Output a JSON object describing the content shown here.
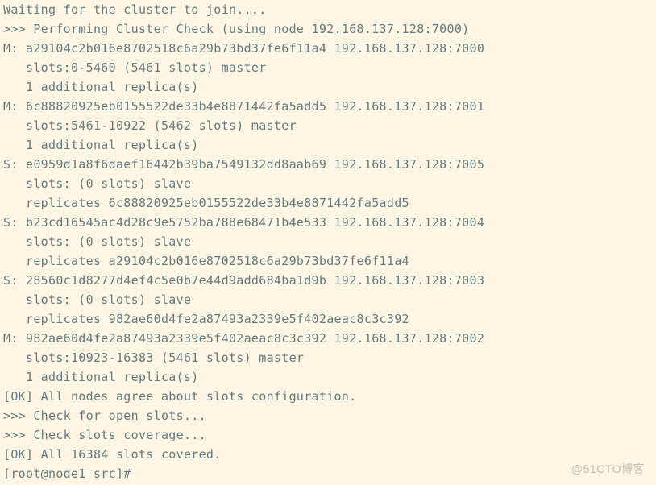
{
  "terminal": {
    "lines": [
      "Waiting for the cluster to join....",
      ">>> Performing Cluster Check (using node 192.168.137.128:7000)",
      "M: a29104c2b016e8702518c6a29b73bd37fe6f11a4 192.168.137.128:7000",
      "   slots:0-5460 (5461 slots) master",
      "   1 additional replica(s)",
      "M: 6c88820925eb0155522de33b4e8871442fa5add5 192.168.137.128:7001",
      "   slots:5461-10922 (5462 slots) master",
      "   1 additional replica(s)",
      "S: e0959d1a8f6daef16442b39ba7549132dd8aab69 192.168.137.128:7005",
      "   slots: (0 slots) slave",
      "   replicates 6c88820925eb0155522de33b4e8871442fa5add5",
      "S: b23cd16545ac4d28c9e5752ba788e68471b4e533 192.168.137.128:7004",
      "   slots: (0 slots) slave",
      "   replicates a29104c2b016e8702518c6a29b73bd37fe6f11a4",
      "S: 28560c1d8277d4ef4c5e0b7e44d9add684ba1d9b 192.168.137.128:7003",
      "   slots: (0 slots) slave",
      "   replicates 982ae60d4fe2a87493a2339e5f402aeac8c3c392",
      "M: 982ae60d4fe2a87493a2339e5f402aeac8c3c392 192.168.137.128:7002",
      "   slots:10923-16383 (5461 slots) master",
      "   1 additional replica(s)",
      "[OK] All nodes agree about slots configuration.",
      ">>> Check for open slots...",
      ">>> Check slots coverage...",
      "[OK] All 16384 slots covered.",
      "[root@node1 src]# "
    ]
  },
  "watermark": "@51CTO博客"
}
